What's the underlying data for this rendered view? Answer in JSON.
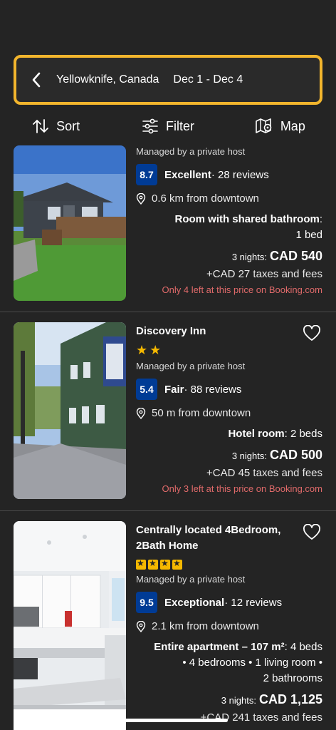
{
  "search": {
    "location": "Yellowknife, Canada",
    "dates": "Dec 1 - Dec 4"
  },
  "actions": {
    "sort": "Sort",
    "filter": "Filter",
    "map": "Map"
  },
  "listings": [
    {
      "name": "",
      "host": "Managed by a private host",
      "score": "8.7",
      "score_word": "Excellent",
      "reviews": " · 28 reviews",
      "distance": "0.6 km from downtown",
      "room_type": "Room with shared bathroom",
      "room_detail": ":",
      "room_line2": "1 bed",
      "nights": "3 nights:",
      "price": "CAD 540",
      "taxes": "+CAD 27 taxes and fees",
      "availability": "Only 4 left at this price on Booking.com"
    },
    {
      "name": "Discovery Inn",
      "stars": 2,
      "host": "Managed by a private host",
      "score": "5.4",
      "score_word": "Fair",
      "reviews": " · 88 reviews",
      "distance": "50 m from downtown",
      "room_type": "Hotel room",
      "room_detail": ": 2 beds",
      "nights": "3 nights:",
      "price": "CAD 500",
      "taxes": "+CAD 45 taxes and fees",
      "availability": "Only 3 left at this price on Booking.com"
    },
    {
      "name": "Centrally located 4Bedroom, 2Bath Home",
      "stars": 4,
      "host": "Managed by a private host",
      "score": "9.5",
      "score_word": "Exceptional",
      "reviews": " · 12 reviews",
      "distance": "2.1 km from downtown",
      "room_type": "Entire apartment – 107 m²",
      "room_detail": ": 4 beds",
      "room_line2": "• 4 bedrooms • 1 living room •",
      "room_line3": "2 bathrooms",
      "nights": "3 nights:",
      "price": "CAD 1,125",
      "taxes": "+CAD 241 taxes and fees"
    }
  ],
  "colors": {
    "accent": "#f2b52d",
    "score_bg": "#003b95",
    "urgency": "#e06a6a",
    "star": "#f5b800"
  }
}
